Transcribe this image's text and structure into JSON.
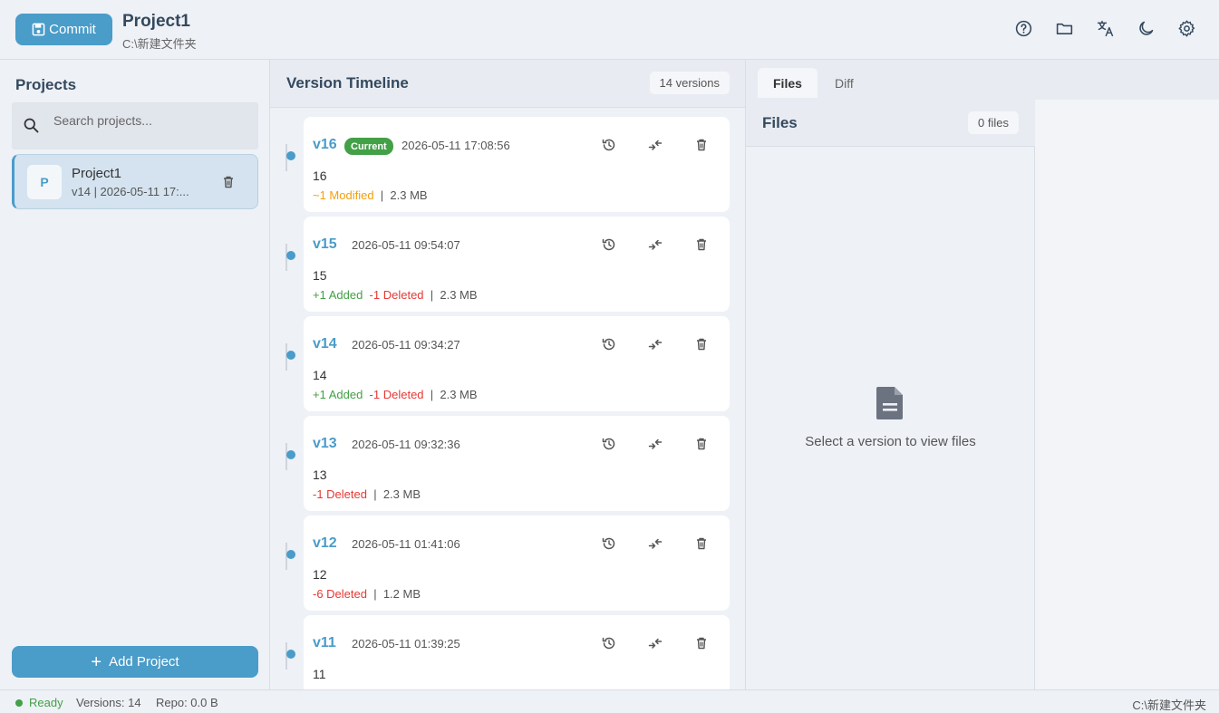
{
  "header": {
    "commit_label": "Commit",
    "project_title": "Project1",
    "project_path": "C:\\新建文件夹",
    "icons": [
      "help-icon",
      "folder-icon",
      "translate-icon",
      "dark-mode-icon",
      "settings-icon"
    ]
  },
  "sidebar": {
    "title": "Projects",
    "search_placeholder": "Search projects...",
    "projects": [
      {
        "avatar": "P",
        "name": "Project1",
        "meta": "v14 | 2026-05-11 17:..."
      }
    ],
    "add_label": "Add Project"
  },
  "timeline": {
    "title": "Version Timeline",
    "count": "14 versions",
    "versions": [
      {
        "label": "v16",
        "badge": "Current",
        "date": "2026-05-11 17:08:56",
        "desc": "16",
        "added": "",
        "deleted": "",
        "modified": "~1 Modified",
        "size": "2.3 MB"
      },
      {
        "label": "v15",
        "badge": "",
        "date": "2026-05-11 09:54:07",
        "desc": "15",
        "added": "+1 Added",
        "deleted": "-1 Deleted",
        "modified": "",
        "size": "2.3 MB"
      },
      {
        "label": "v14",
        "badge": "",
        "date": "2026-05-11 09:34:27",
        "desc": "14",
        "added": "+1 Added",
        "deleted": "-1 Deleted",
        "modified": "",
        "size": "2.3 MB"
      },
      {
        "label": "v13",
        "badge": "",
        "date": "2026-05-11 09:32:36",
        "desc": "13",
        "added": "",
        "deleted": "-1 Deleted",
        "modified": "",
        "size": "2.3 MB"
      },
      {
        "label": "v12",
        "badge": "",
        "date": "2026-05-11 01:41:06",
        "desc": "12",
        "added": "",
        "deleted": "-6 Deleted",
        "modified": "",
        "size": "1.2 MB"
      },
      {
        "label": "v11",
        "badge": "",
        "date": "2026-05-11 01:39:25",
        "desc": "11",
        "added": "",
        "deleted": "",
        "modified": "",
        "size": ""
      }
    ]
  },
  "right": {
    "tabs": [
      "Files",
      "Diff"
    ],
    "active_tab": "Files",
    "files_title": "Files",
    "files_count": "0 files",
    "empty_text": "Select a version to view files"
  },
  "status": {
    "ready": "Ready",
    "versions": "Versions: 14",
    "repo": "Repo: 0.0 B",
    "path": "C:\\新建文件夹"
  },
  "colors": {
    "accent": "#4a9cc9",
    "added": "#43a047",
    "deleted": "#e53935",
    "modified": "#f59e0b"
  }
}
